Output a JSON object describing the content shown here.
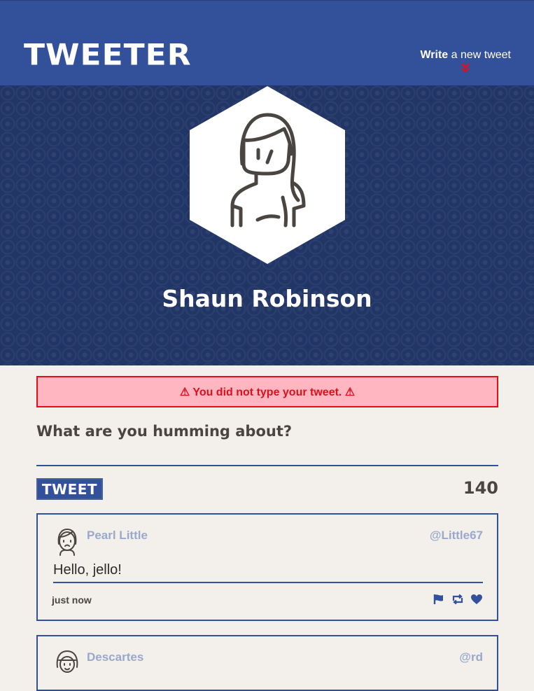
{
  "header": {
    "logo": "TWEETER",
    "compose_bold": "Write",
    "compose_rest": " a new tweet"
  },
  "profile": {
    "name": "Shaun Robinson"
  },
  "composer": {
    "error": "⚠ You did not type your tweet. ⚠",
    "prompt": "What are you humming about?",
    "input_value": "",
    "button_label": "TWEET",
    "char_count": "140"
  },
  "tweets": [
    {
      "author": "Pearl Little",
      "handle": "@Little67",
      "content": "Hello, jello!",
      "time": "just now"
    },
    {
      "author": "Descartes",
      "handle": "@rd"
    }
  ],
  "icons": {
    "compose": "chevron-double-down-icon",
    "flag": "flag-icon",
    "retweet": "retweet-icon",
    "like": "heart-icon"
  },
  "colors": {
    "header": "#33509a",
    "profile_bg": "#213566",
    "page_bg": "#f3f0ec",
    "error": "#e00f1b",
    "error_bg": "#ffb6c1",
    "muted": "#9aa8cb"
  }
}
